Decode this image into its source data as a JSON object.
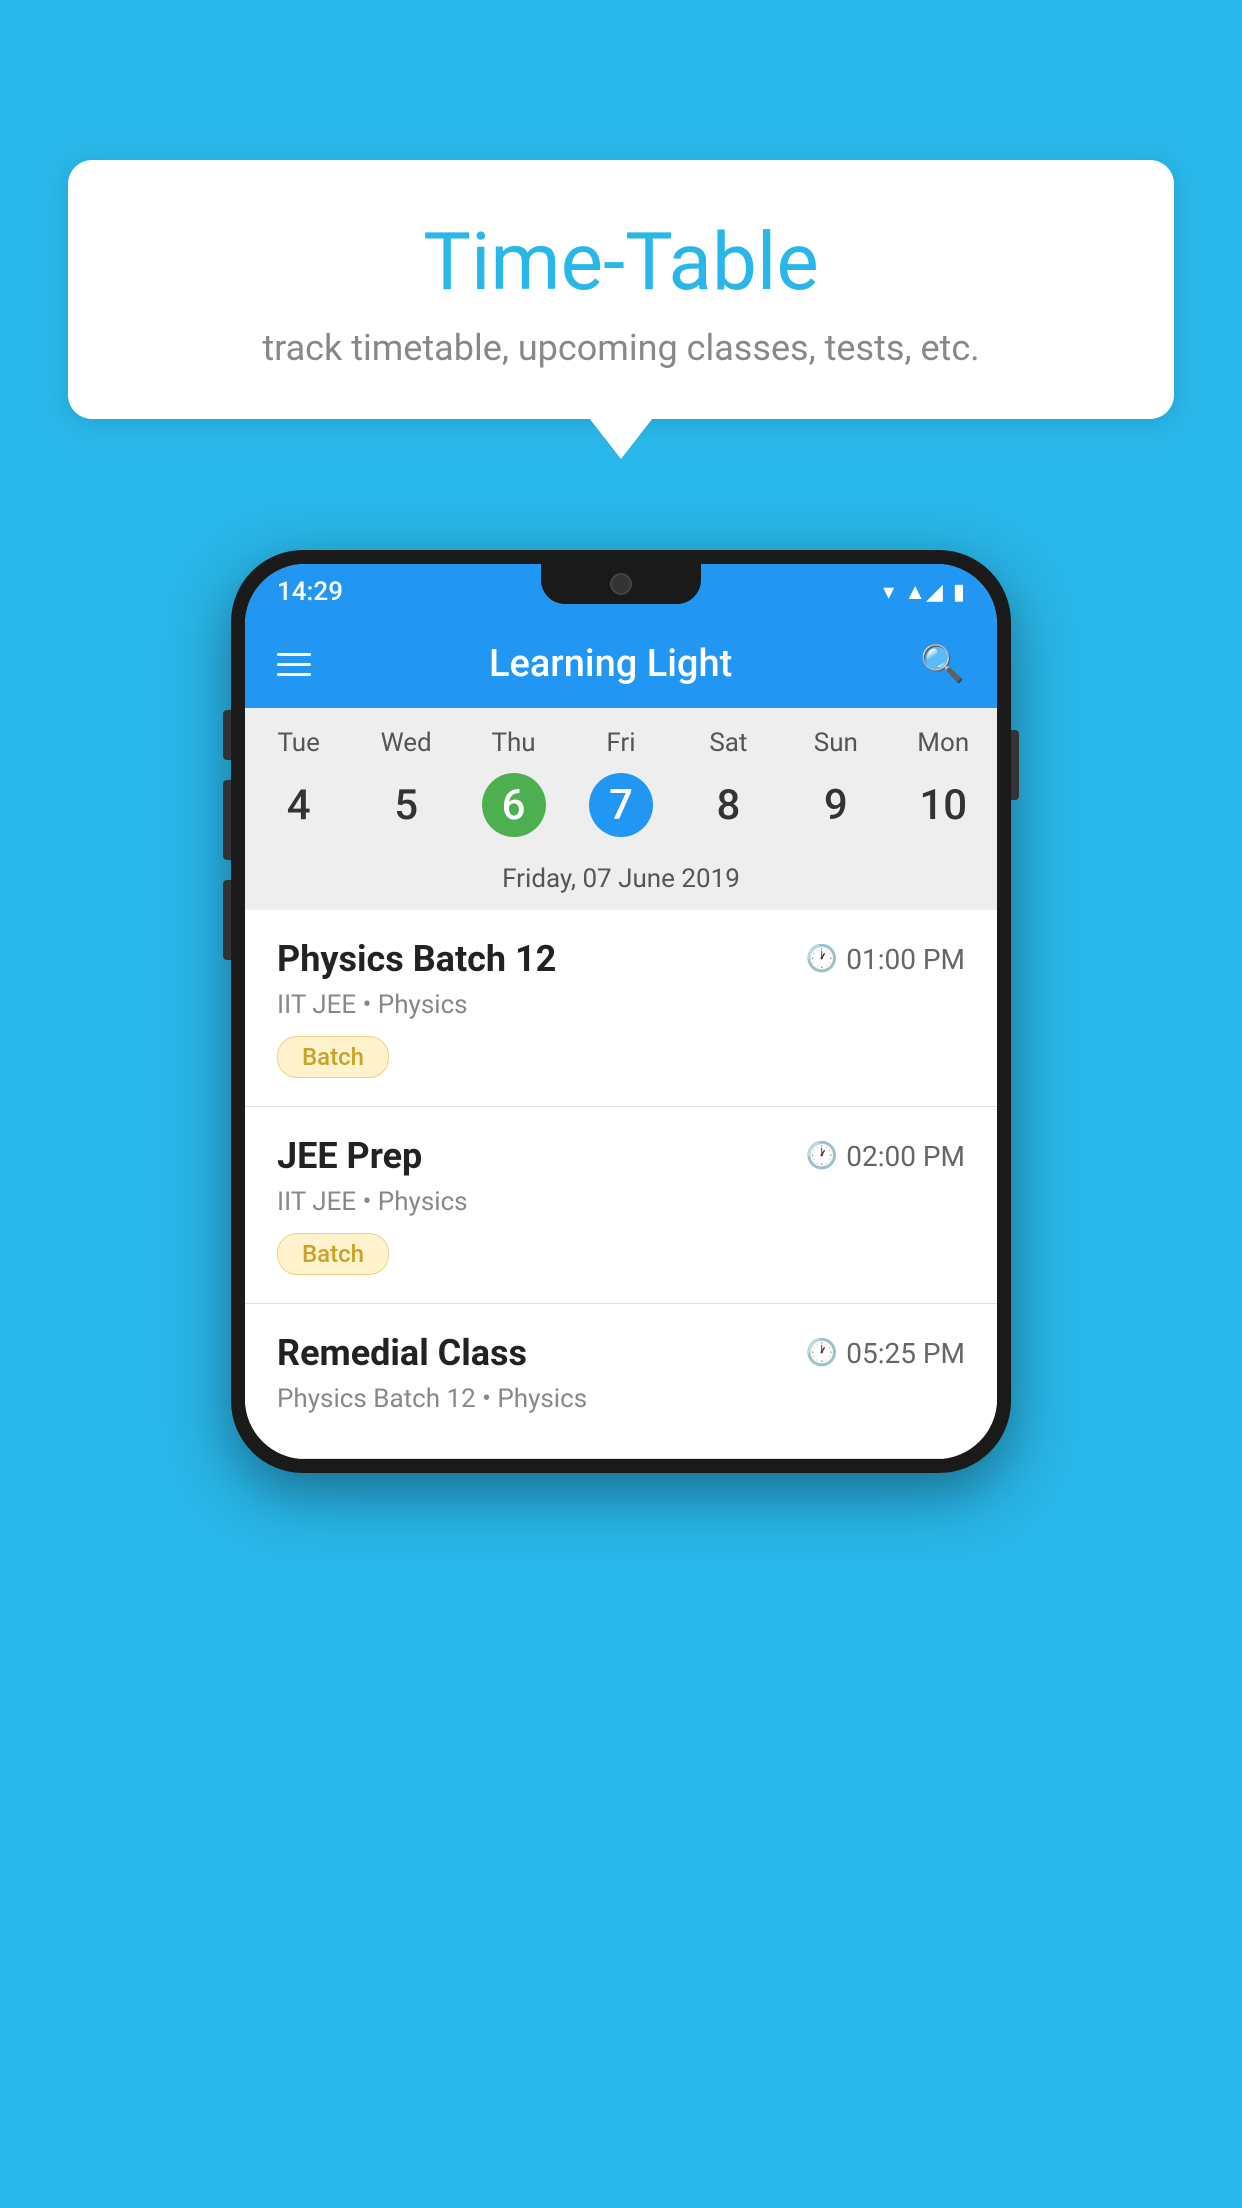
{
  "background": {
    "color": "#29b6e8"
  },
  "tooltip": {
    "title": "Time-Table",
    "subtitle": "track timetable, upcoming classes, tests, etc."
  },
  "phone": {
    "status_bar": {
      "time": "14:29"
    },
    "toolbar": {
      "title": "Learning Light",
      "menu_icon": "menu-icon",
      "search_icon": "search-icon"
    },
    "calendar": {
      "days": [
        {
          "label": "Tue",
          "number": "4"
        },
        {
          "label": "Wed",
          "number": "5"
        },
        {
          "label": "Thu",
          "number": "6",
          "is_today": true
        },
        {
          "label": "Fri",
          "number": "7",
          "is_selected": true
        },
        {
          "label": "Sat",
          "number": "8"
        },
        {
          "label": "Sun",
          "number": "9"
        },
        {
          "label": "Mon",
          "number": "10"
        }
      ],
      "selected_date_label": "Friday, 07 June 2019"
    },
    "schedule": [
      {
        "title": "Physics Batch 12",
        "time": "01:00 PM",
        "subtitle": "IIT JEE • Physics",
        "badge": "Batch"
      },
      {
        "title": "JEE Prep",
        "time": "02:00 PM",
        "subtitle": "IIT JEE • Physics",
        "badge": "Batch"
      },
      {
        "title": "Remedial Class",
        "time": "05:25 PM",
        "subtitle": "Physics Batch 12 • Physics",
        "badge": null
      }
    ]
  }
}
